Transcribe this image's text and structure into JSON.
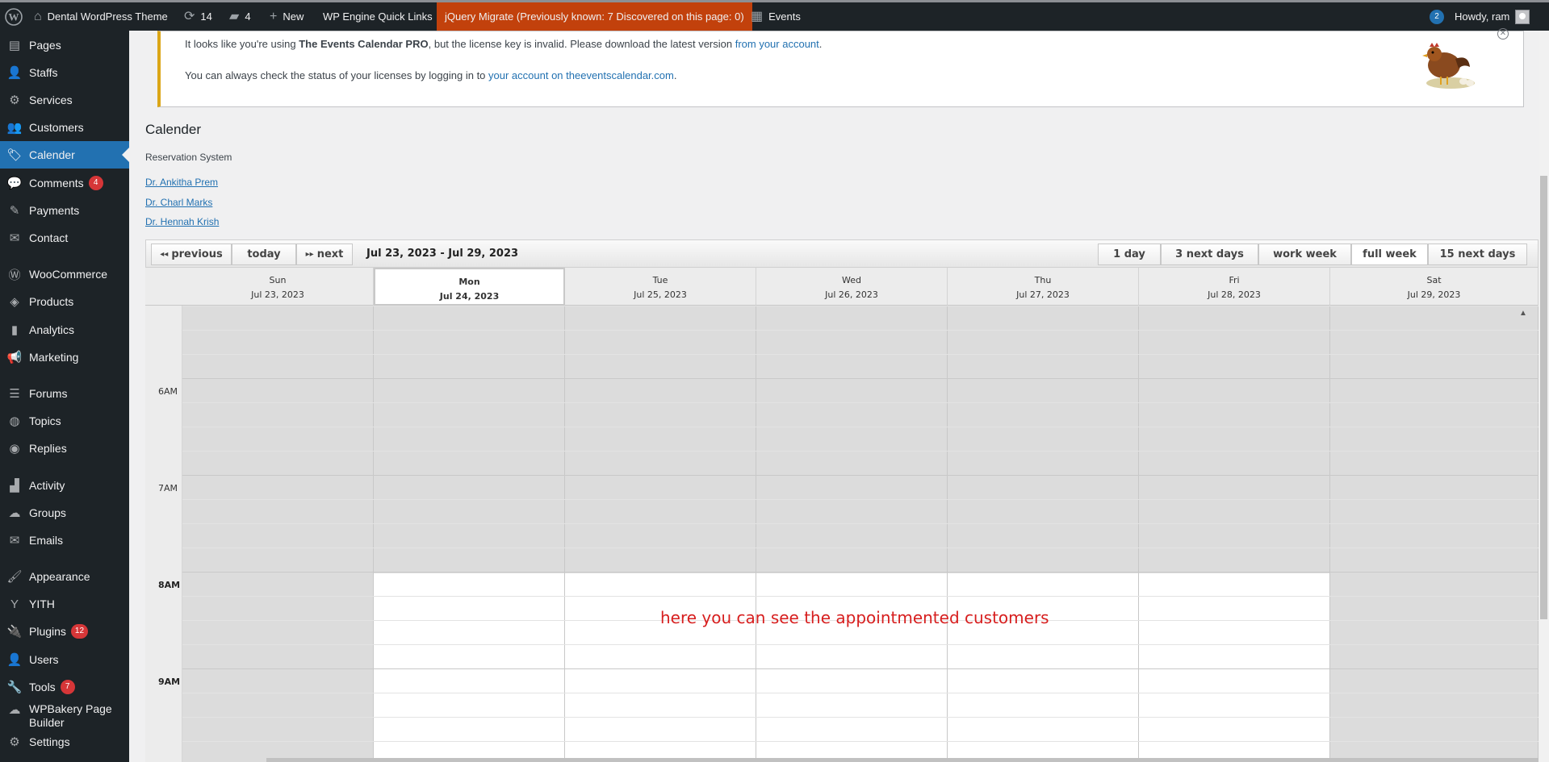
{
  "adminbar": {
    "site_name": "Dental WordPress Theme",
    "updates_count": "14",
    "comments_count": "4",
    "new_label": "New",
    "wpengine_label": "WP Engine Quick Links",
    "jquery_label": "jQuery Migrate (Previously known: 7 Discovered on this page: 0)",
    "events_label": "Events",
    "notif_count": "2",
    "howdy": "Howdy, ram"
  },
  "sidebar": {
    "items": [
      {
        "label": "Pages",
        "icon": "pages-icon",
        "glyph": "▤"
      },
      {
        "label": "Staffs",
        "icon": "staffs-icon",
        "glyph": "👤"
      },
      {
        "label": "Services",
        "icon": "services-icon",
        "glyph": "⚙"
      },
      {
        "label": "Customers",
        "icon": "customers-icon",
        "glyph": "👥"
      },
      {
        "label": "Calender",
        "icon": "calender-icon",
        "glyph": "🏷",
        "current": true
      },
      {
        "label": "Comments",
        "icon": "comments-icon",
        "glyph": "💬",
        "count": "4"
      },
      {
        "label": "Payments",
        "icon": "payments-icon",
        "glyph": "✎"
      },
      {
        "label": "Contact",
        "icon": "contact-icon",
        "glyph": "✉"
      },
      {
        "label": "WooCommerce",
        "icon": "woocommerce-icon",
        "glyph": "Ⓦ"
      },
      {
        "label": "Products",
        "icon": "products-icon",
        "glyph": "◈"
      },
      {
        "label": "Analytics",
        "icon": "analytics-icon",
        "glyph": "▮"
      },
      {
        "label": "Marketing",
        "icon": "marketing-icon",
        "glyph": "📢"
      },
      {
        "label": "Forums",
        "icon": "forums-icon",
        "glyph": "☰"
      },
      {
        "label": "Topics",
        "icon": "topics-icon",
        "glyph": "◍"
      },
      {
        "label": "Replies",
        "icon": "replies-icon",
        "glyph": "◉"
      },
      {
        "label": "Activity",
        "icon": "activity-icon",
        "glyph": "▟"
      },
      {
        "label": "Groups",
        "icon": "groups-icon",
        "glyph": "☁"
      },
      {
        "label": "Emails",
        "icon": "emails-icon",
        "glyph": "✉"
      },
      {
        "label": "Appearance",
        "icon": "appearance-icon",
        "glyph": "🖌"
      },
      {
        "label": "YITH",
        "icon": "yith-icon",
        "glyph": "Y"
      },
      {
        "label": "Plugins",
        "icon": "plugins-icon",
        "glyph": "🔌",
        "count": "12"
      },
      {
        "label": "Users",
        "icon": "users-icon",
        "glyph": "👤"
      },
      {
        "label": "Tools",
        "icon": "tools-icon",
        "glyph": "🔧",
        "count": "7"
      },
      {
        "label": "WPBakery Page Builder",
        "icon": "wpbakery-icon",
        "glyph": "☁"
      },
      {
        "label": "Settings",
        "icon": "settings-icon",
        "glyph": "⚙"
      }
    ]
  },
  "notice": {
    "line1_pre": "It looks like you're using ",
    "line1_strong": "The Events Calendar PRO",
    "line1_mid": ", but the license key is invalid. Please download the latest version ",
    "line1_link": "from your account",
    "line1_end": ".",
    "line2_pre": "You can always check the status of your licenses by logging in to ",
    "line2_link": "your account on theeventscalendar.com",
    "line2_end": "."
  },
  "page": {
    "title": "Calender",
    "subtitle": "Reservation System",
    "doctors": [
      "Dr. Ankitha Prem",
      "Dr. Charl Marks",
      "Dr. Hennah Krish"
    ]
  },
  "calendar": {
    "nav": {
      "previous": "previous",
      "today": "today",
      "next": "next"
    },
    "range": "Jul 23, 2023 - Jul 29, 2023",
    "views": [
      "1 day",
      "3 next days",
      "work week",
      "full week",
      "15 next days"
    ],
    "active_view": "full week",
    "days": [
      {
        "name": "Sun",
        "date": "Jul 23, 2023"
      },
      {
        "name": "Mon",
        "date": "Jul 24, 2023",
        "today": true
      },
      {
        "name": "Tue",
        "date": "Jul 25, 2023"
      },
      {
        "name": "Wed",
        "date": "Jul 26, 2023"
      },
      {
        "name": "Thu",
        "date": "Jul 27, 2023"
      },
      {
        "name": "Fri",
        "date": "Jul 28, 2023"
      },
      {
        "name": "Sat",
        "date": "Jul 29, 2023"
      }
    ],
    "hours": [
      "6AM",
      "7AM",
      "8AM",
      "9AM"
    ]
  },
  "annotation": "here you can see the appointmented customers",
  "colors": {
    "accent": "#2271b1",
    "admin_bg": "#1d2327",
    "jquery_bg": "#c2410c",
    "annotation": "#d71e1e",
    "notice_border": "#dba617"
  }
}
